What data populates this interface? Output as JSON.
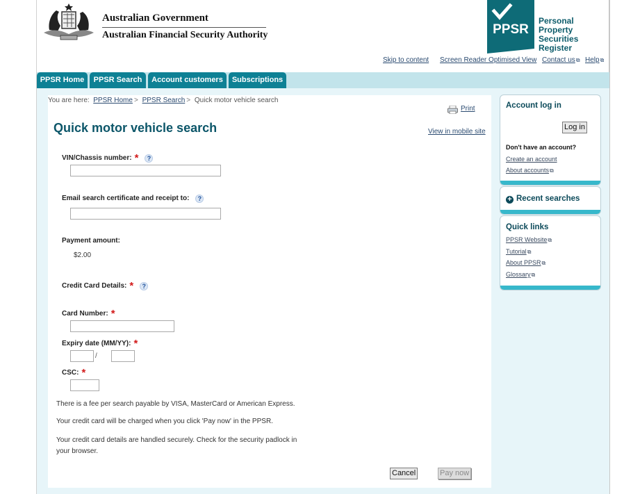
{
  "header": {
    "gov_title": "Australian Government",
    "gov_subtitle": "Australian Financial Security Authority",
    "logo_text": "PPSR",
    "register_name_line1": "Personal Property",
    "register_name_line2": "Securities Register",
    "brand_color": "#0e6b77"
  },
  "util_links": {
    "skip": "Skip to content",
    "screen_reader": "Screen Reader Optimised View",
    "contact": "Contact us",
    "help": "Help"
  },
  "tabs": [
    {
      "label": "PPSR Home"
    },
    {
      "label": "PPSR Search"
    },
    {
      "label": "Account customers"
    },
    {
      "label": "Subscriptions"
    }
  ],
  "breadcrumb": {
    "prefix": "You are here:",
    "items": [
      "PPSR Home",
      "PPSR Search"
    ],
    "current": "Quick motor vehicle search",
    "separator": ">"
  },
  "page": {
    "print": "Print",
    "mobile": "View in mobile site",
    "title": "Quick motor vehicle search"
  },
  "form": {
    "vin_label": "VIN/Chassis number:",
    "vin_value": "",
    "email_label": "Email search certificate and receipt to:",
    "email_value": "",
    "payment_label": "Payment amount:",
    "payment_value": "$2.00",
    "cc_label": "Credit Card Details:",
    "card_number_label": "Card Number:",
    "card_number_value": "",
    "expiry_label": "Expiry date (MM/YY):",
    "expiry_month": "",
    "expiry_year": "",
    "expiry_separator": "/",
    "csc_label": "CSC:",
    "csc_value": "",
    "required_mark": "*",
    "help_mark": "?"
  },
  "notes": [
    "There is a fee per search payable by VISA, MasterCard or American Express.",
    "Your credit card will be charged when you click 'Pay now' in the PPSR.",
    "Your credit card details are handled securely. Check for the security padlock in your browser."
  ],
  "buttons": {
    "cancel": "Cancel",
    "pay_now": "Pay now"
  },
  "sidebar": {
    "account": {
      "title": "Account log in",
      "login_button": "Log in",
      "no_account": "Don't have an account?",
      "create": "Create an account",
      "about": "About accounts"
    },
    "recent": {
      "title": "Recent searches"
    },
    "quick_links": {
      "title": "Quick links",
      "items": [
        "PPSR Website",
        "Tutorial",
        "About PPSR",
        "Glossary"
      ]
    }
  }
}
